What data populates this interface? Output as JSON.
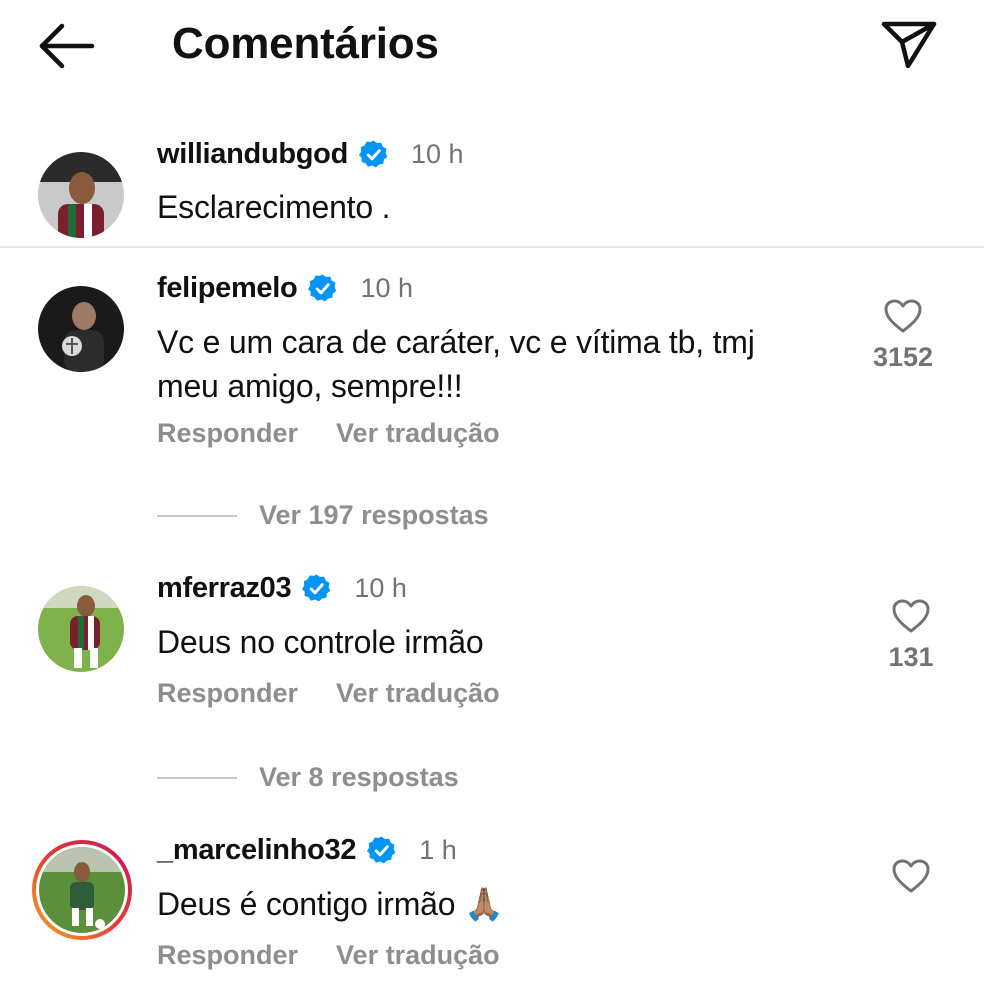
{
  "header": {
    "title": "Comentários"
  },
  "caption": {
    "username": "williandubgod",
    "time": "10 h",
    "text": "Esclarecimento ."
  },
  "comments": [
    {
      "username": "felipemelo",
      "time": "10 h",
      "text_line1": "Vc e um cara de caráter, vc e vítima tb, tmj",
      "text_line2": "meu amigo, sempre!!!",
      "likes": "3152",
      "reply_label": "Responder",
      "translate_label": "Ver tradução",
      "view_replies": "Ver 197 respostas"
    },
    {
      "username": "mferraz03",
      "time": "10 h",
      "text": "Deus no controle irmão",
      "likes": "131",
      "reply_label": "Responder",
      "translate_label": "Ver tradução",
      "view_replies": "Ver 8 respostas"
    },
    {
      "username": "_marcelinho32",
      "time": "1 h",
      "text": "Deus é contigo irmão 🙏🏽",
      "reply_label": "Responder",
      "translate_label": "Ver tradução"
    }
  ],
  "colors": {
    "verified": "#0095f6",
    "secondary_text": "#8e8e8e",
    "story_ring_start": "#f9a825",
    "story_ring_end": "#c2185b"
  },
  "icons": {
    "back": "arrow-left-icon",
    "share": "paper-plane-icon",
    "verified": "verified-badge-icon",
    "like": "heart-outline-icon"
  }
}
